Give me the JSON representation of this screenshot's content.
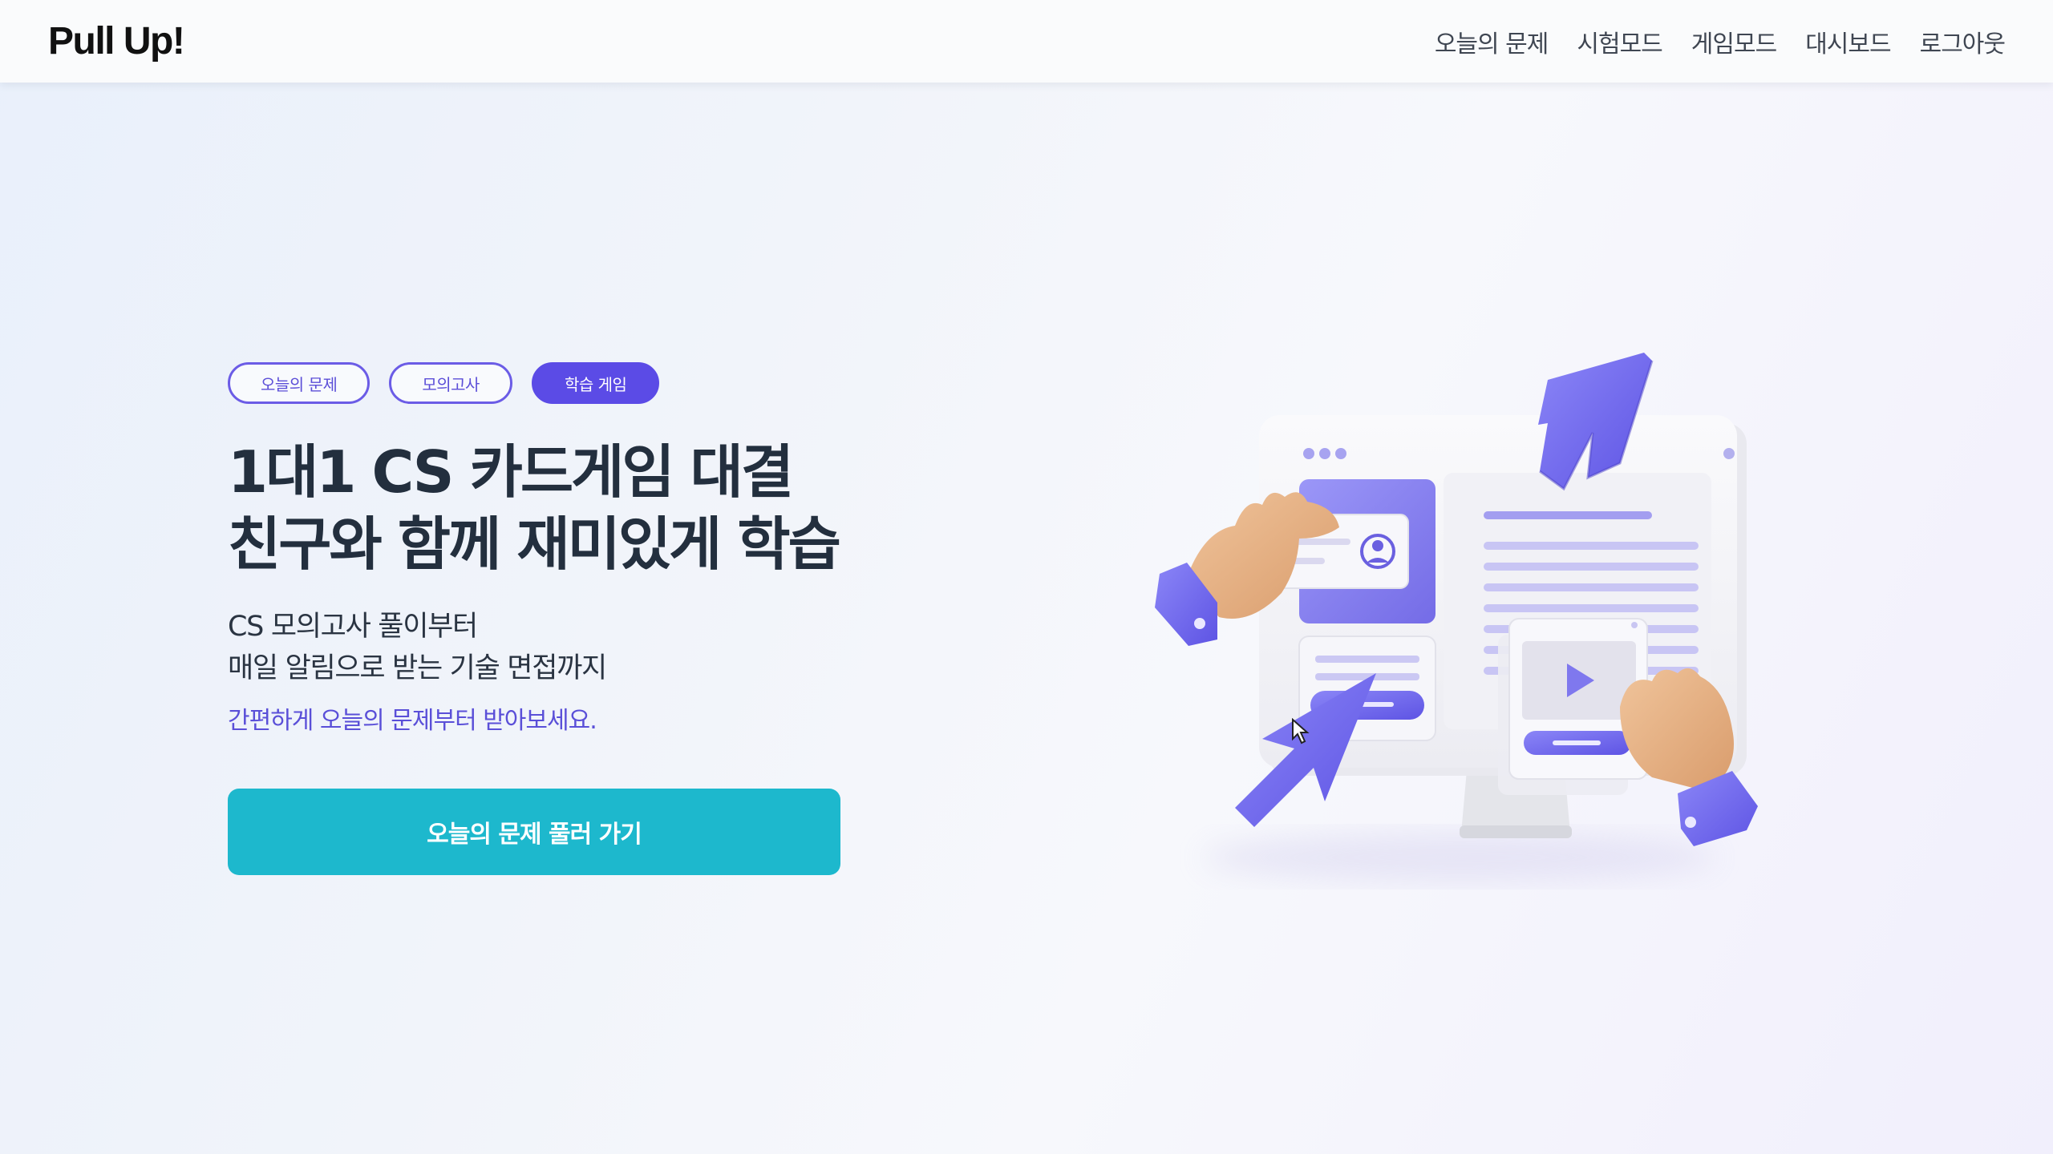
{
  "header": {
    "logo": "Pull Up!",
    "nav": [
      {
        "label": "오늘의 문제"
      },
      {
        "label": "시험모드"
      },
      {
        "label": "게임모드"
      },
      {
        "label": "대시보드"
      },
      {
        "label": "로그아웃"
      }
    ]
  },
  "hero": {
    "pills": [
      {
        "label": "오늘의 문제",
        "active": false
      },
      {
        "label": "모의고사",
        "active": false
      },
      {
        "label": "학습 게임",
        "active": true
      }
    ],
    "title_line1": "1대1 CS 카드게임 대결",
    "title_line2": "친구와 함께 재미있게 학습",
    "sub_line1": "CS 모의고사 풀이부터",
    "sub_line2": "매일 알림으로 받는 기술 면접까지",
    "hint": "간편하게 오늘의 문제부터 받아보세요.",
    "cta_label": "오늘의 문제 풀러 가기"
  },
  "illustration": {
    "icons": [
      "monitor-icon",
      "hand-icon",
      "cursor-arrow-icon",
      "profile-card-icon",
      "play-video-icon",
      "logo-w-icon"
    ]
  },
  "colors": {
    "accent": "#5b4be6",
    "cta": "#1db8cd",
    "title": "#232f3e"
  }
}
